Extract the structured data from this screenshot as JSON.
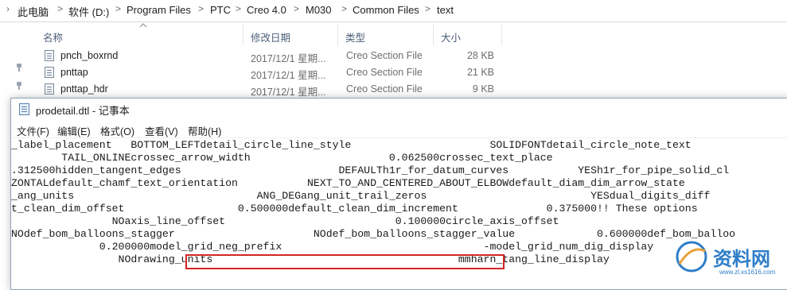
{
  "explorer": {
    "breadcrumb": [
      "此电脑",
      "软件 (D:)",
      "Program Files",
      "PTC",
      "Creo 4.0",
      "M030",
      "Common Files",
      "text"
    ],
    "breadcrumb_separator": ">",
    "columns": [
      "名称",
      "修改日期",
      "类型",
      "大小"
    ],
    "files": [
      {
        "name": "pnch_boxrnd",
        "date": "2017/12/1 星期...",
        "type": "Creo Section File",
        "size": "28 KB"
      },
      {
        "name": "pnttap",
        "date": "2017/12/1 星期...",
        "type": "Creo Section File",
        "size": "21 KB"
      },
      {
        "name": "pnttap_hdr",
        "date": "2017/12/1 星期...",
        "type": "Creo Section File",
        "size": "9 KB"
      }
    ]
  },
  "notepad": {
    "title": "prodetail.dtl - 记事本",
    "menu": [
      "文件(F)",
      "编辑(E)",
      "格式(O)",
      "查看(V)",
      "帮助(H)"
    ],
    "lines": [
      "_label_placement   BOTTOM_LEFTdetail_circle_line_style                      SOLIDFONTdetail_circle_note_text",
      "        TAIL_ONLINEcrossec_arrow_width                      0.062500crossec_text_place",
      ".312500hidden_tangent_edges                         DEFAULTh1r_for_datum_curves           YESh1r_for_pipe_solid_cl",
      "ZONTALdefault_chamf_text_orientation           NEXT_TO_AND_CENTERED_ABOUT_ELBOWdefault_diam_dim_arrow_state",
      "_ang_units                             ANG_DEGang_unit_trail_zeros                          YESdual_digits_diff",
      "t_clean_dim_offset                  0.500000default_clean_dim_increment              0.375000!! These options",
      "                NOaxis_line_offset                           0.100000circle_axis_offset",
      "NOdef_bom_balloons_stagger                      NOdef_bom_balloons_stagger_value             0.600000def_bom_balloo",
      "              0.200000model_grid_neg_prefix                                -model_grid_num_dig_display",
      "                 NOdrawing_units                                       mmharn_tang_line_display"
    ]
  },
  "watermark": {
    "brand": "资料网",
    "url": "www.zl.xs1616.com"
  }
}
